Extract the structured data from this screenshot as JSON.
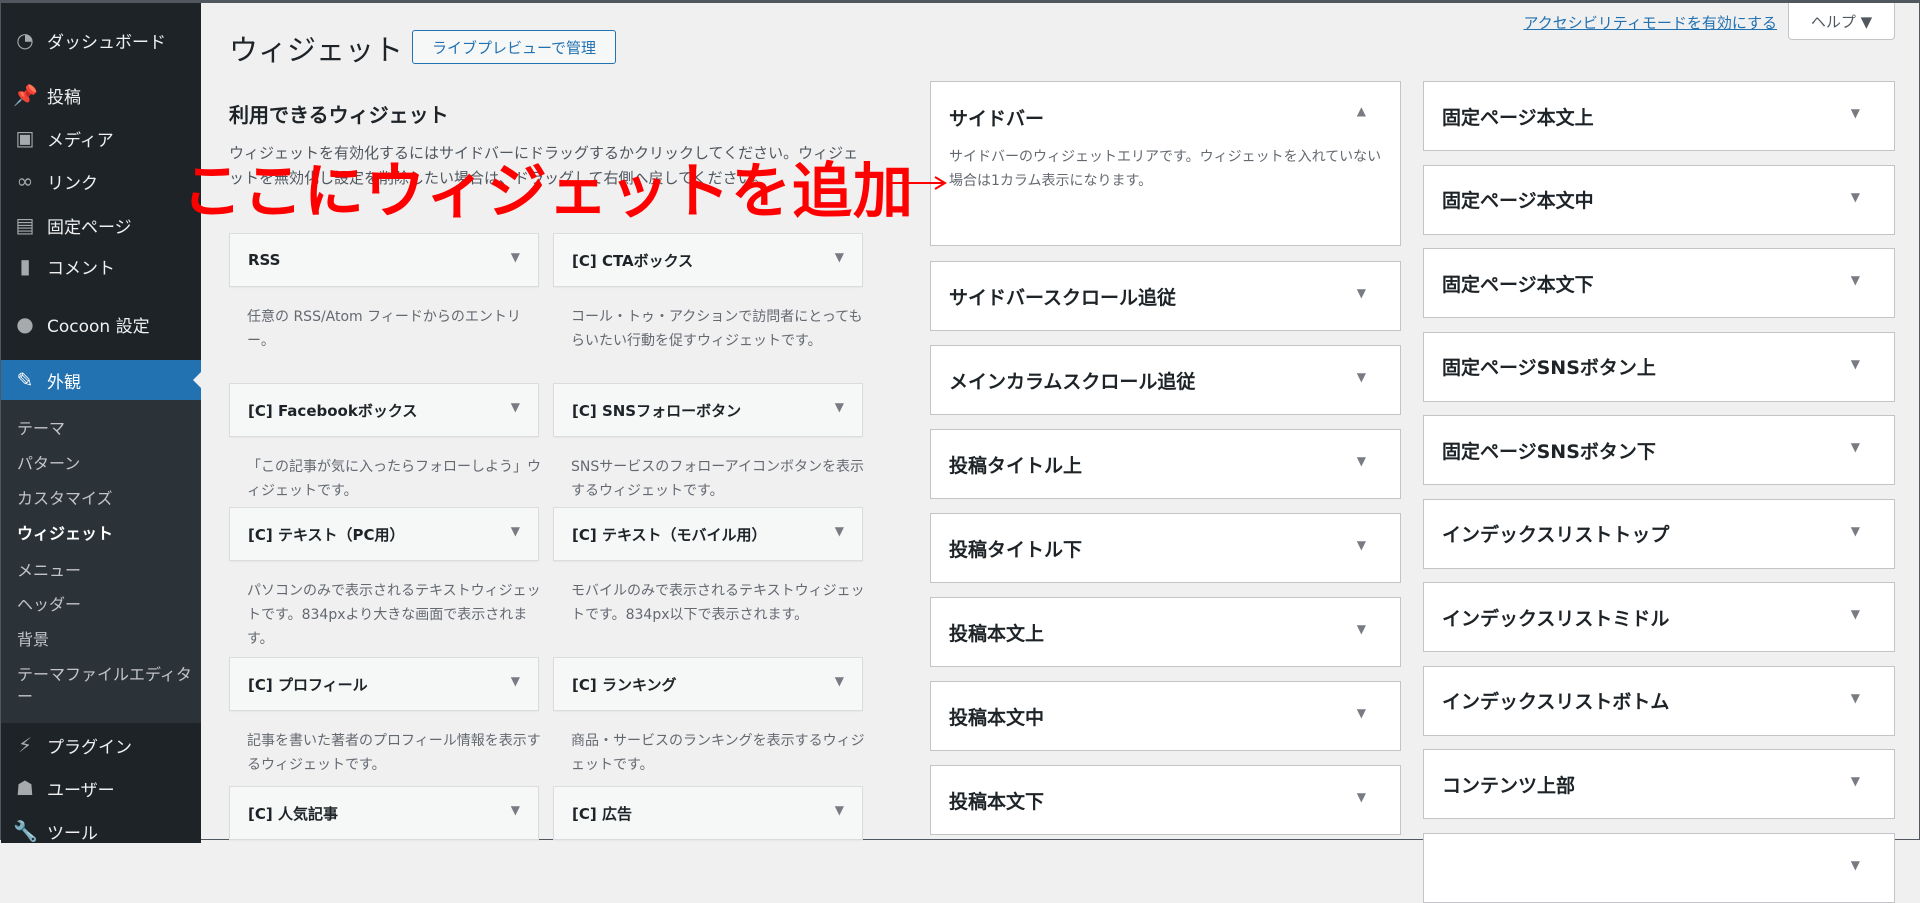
{
  "sidebar": {
    "items": [
      {
        "label": "ダッシュボード",
        "icon": "dashboard-icon"
      },
      {
        "label": "投稿",
        "icon": "pin-icon"
      },
      {
        "label": "メディア",
        "icon": "media-icon"
      },
      {
        "label": "リンク",
        "icon": "link-icon"
      },
      {
        "label": "固定ページ",
        "icon": "page-icon"
      },
      {
        "label": "コメント",
        "icon": "comment-icon"
      },
      {
        "label": "Cocoon 設定",
        "icon": "circle-icon"
      },
      {
        "label": "外観",
        "icon": "brush-icon",
        "active": true
      },
      {
        "label": "プラグイン",
        "icon": "plugin-icon"
      },
      {
        "label": "ユーザー",
        "icon": "user-icon"
      },
      {
        "label": "ツール",
        "icon": "wrench-icon"
      }
    ],
    "submenu": [
      "テーマ",
      "パターン",
      "カスタマイズ",
      "ウィジェット",
      "メニュー",
      "ヘッダー",
      "背景",
      "テーマファイルエディター"
    ],
    "current_submenu": "ウィジェット"
  },
  "header": {
    "title": "ウィジェット",
    "live_preview": "ライブプレビューで管理",
    "accessibility_link": "アクセシビリティモードを有効にする",
    "help": "ヘルプ ▼"
  },
  "available": {
    "title": "利用できるウィジェット",
    "description": "ウィジェットを有効化するにはサイドバーにドラッグするかクリックしてください。ウィジェットを無効化し設定を削除したい場合は、ドラッグして右側へ戻してください。",
    "widgets": [
      {
        "title": "RSS",
        "desc": "任意の RSS/Atom フィードからのエントリー。"
      },
      {
        "title": "[C] CTAボックス",
        "desc": "コール・トゥ・アクションで訪問者にとってもらいたい行動を促すウィジェットです。"
      },
      {
        "title": "[C] Facebookボックス",
        "desc": "「この記事が気に入ったらフォローしよう」ウィジェットです。"
      },
      {
        "title": "[C] SNSフォローボタン",
        "desc": "SNSサービスのフォローアイコンボタンを表示するウィジェットです。"
      },
      {
        "title": "[C] テキスト（PC用）",
        "desc": "パソコンのみで表示されるテキストウィジェットです。834pxより大きな画面で表示されます。"
      },
      {
        "title": "[C] テキスト（モバイル用）",
        "desc": "モバイルのみで表示されるテキストウィジェットです。834px以下で表示されます。"
      },
      {
        "title": "[C] プロフィール",
        "desc": "記事を書いた著者のプロフィール情報を表示するウィジェットです。"
      },
      {
        "title": "[C] ランキング",
        "desc": "商品・サービスのランキングを表示するウィジェットです。"
      },
      {
        "title": "[C] 人気記事",
        "desc": ""
      },
      {
        "title": "[C] 広告",
        "desc": ""
      }
    ]
  },
  "sidebar_area": {
    "title": "サイドバー",
    "desc": "サイドバーのウィジェットエリアです。ウィジェットを入れていない場合は1カラム表示になります。"
  },
  "areas_a": [
    "サイドバースクロール追従",
    "メインカラムスクロール追従",
    "投稿タイトル上",
    "投稿タイトル下",
    "投稿本文上",
    "投稿本文中",
    "投稿本文下"
  ],
  "areas_b": [
    "固定ページ本文上",
    "固定ページ本文中",
    "固定ページ本文下",
    "固定ページSNSボタン上",
    "固定ページSNSボタン下",
    "インデックスリストトップ",
    "インデックスリストミドル",
    "インデックスリストボトム",
    "コンテンツ上部",
    ""
  ],
  "annotation": {
    "text": "ここにウィジェットを追加",
    "color": "#ff0000"
  },
  "colors": {
    "accent": "#2271b1",
    "sidebar": "#1d2327"
  }
}
